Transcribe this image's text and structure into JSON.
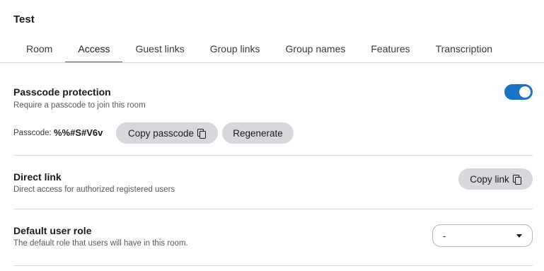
{
  "header": {
    "title": "Test"
  },
  "tabs": [
    {
      "label": "Room"
    },
    {
      "label": "Access",
      "active": true
    },
    {
      "label": "Guest links"
    },
    {
      "label": "Group links"
    },
    {
      "label": "Group names"
    },
    {
      "label": "Features"
    },
    {
      "label": "Transcription"
    }
  ],
  "passcode_protection": {
    "title": "Passcode protection",
    "description": "Require a passcode to join this room",
    "enabled": true,
    "passcode_label": "Passcode:",
    "passcode_value": "%%#S#V6v",
    "copy_label": "Copy passcode",
    "copy_icon": "copy-icon",
    "regenerate_label": "Regenerate"
  },
  "direct_link": {
    "title": "Direct link",
    "description": "Direct access for authorized registered users",
    "copy_label": "Copy link",
    "copy_icon": "copy-icon"
  },
  "default_user_role": {
    "title": "Default user role",
    "description": "The default role that users will have in this room.",
    "selected": "-",
    "dropdown_icon": "chevron-down-icon"
  },
  "colors": {
    "accent": "#1a73c9",
    "button_bg": "#d7d7dc",
    "divider": "#dcdcdc"
  }
}
